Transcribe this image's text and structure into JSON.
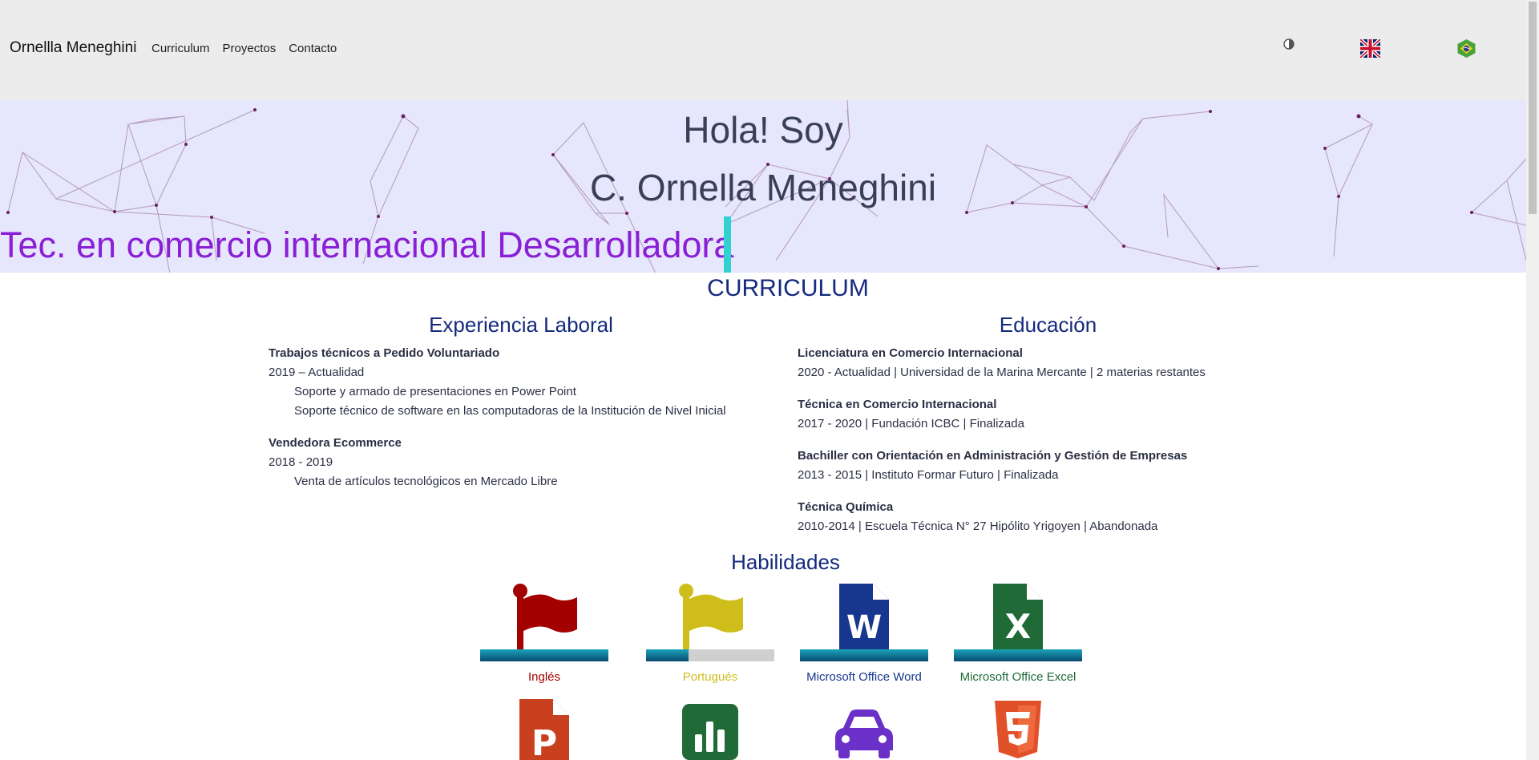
{
  "navbar": {
    "brand": "Ornellla Meneghini",
    "links": [
      "Curriculum",
      "Proyectos",
      "Contacto"
    ],
    "theme_icon": "contrast-icon",
    "lang_en_icon": "uk-flag-icon",
    "lang_pt_icon": "brazil-flag-icon"
  },
  "hero": {
    "line1": "Hola! Soy",
    "line2": "C. Ornella Meneghini",
    "typed": "Tec. en comercio internacional Desarrolladora"
  },
  "curriculum": {
    "title": "CURRICULUM",
    "experience": {
      "title": "Experiencia Laboral",
      "items": [
        {
          "role": "Trabajos técnicos a Pedido Voluntariado",
          "period": "2019 – Actualidad",
          "details": [
            "Soporte y armado de presentaciones en Power Point",
            "Soporte técnico de software en las computadoras de la Institución de Nivel Inicial"
          ]
        },
        {
          "role": "Vendedora Ecommerce",
          "period": "2018 - 2019",
          "details": [
            "Venta de artículos tecnológicos en Mercado Libre"
          ]
        }
      ]
    },
    "education": {
      "title": "Educación",
      "items": [
        {
          "degree": "Licenciatura en Comercio Internacional",
          "info": "2020 - Actualidad | Universidad de la Marina Mercante | 2 materias restantes"
        },
        {
          "degree": "Técnica en Comercio Internacional",
          "info": "2017 - 2020 | Fundación ICBC | Finalizada"
        },
        {
          "degree": "Bachiller con Orientación en Administración y Gestión de Empresas",
          "info": "2013 - 2015 | Instituto Formar Futuro | Finalizada"
        },
        {
          "degree": "Técnica Química",
          "info": "2010-2014 | Escuela Técnica N° 27 Hipólito Yrigoyen | Abandonada"
        }
      ]
    }
  },
  "skills": {
    "title": "Habilidades",
    "items": [
      {
        "label": "Inglés",
        "icon": "red-flag-icon",
        "level": 1.0,
        "color": "#a30000"
      },
      {
        "label": "Portugués",
        "icon": "yellow-flag-icon",
        "level": 0.33,
        "color": "#cfbd1c"
      },
      {
        "label": "Microsoft Office Word",
        "icon": "word-file-icon",
        "level": 1.0,
        "color": "#17378f"
      },
      {
        "label": "Microsoft Office Excel",
        "icon": "excel-file-icon",
        "level": 1.0,
        "color": "#1f6a36"
      },
      {
        "label": "",
        "icon": "powerpoint-file-icon",
        "color": "#c9401f"
      },
      {
        "label": "",
        "icon": "chart-square-icon",
        "color": "#1f6a36"
      },
      {
        "label": "",
        "icon": "car-icon",
        "color": "#6b30c8"
      },
      {
        "label": "",
        "icon": "html5-icon",
        "color": "#e0512a"
      }
    ]
  }
}
